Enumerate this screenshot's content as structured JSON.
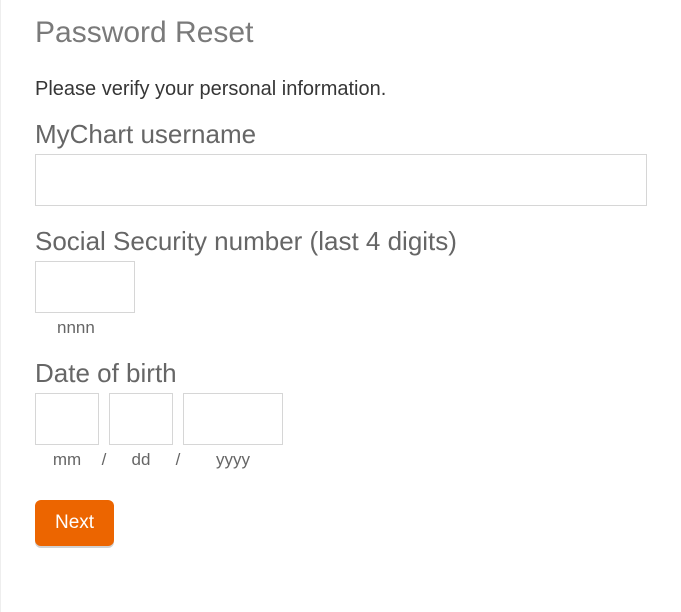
{
  "page": {
    "title": "Password Reset",
    "instruction": "Please verify your personal information."
  },
  "form": {
    "username": {
      "label": "MyChart username",
      "value": ""
    },
    "ssn": {
      "label": "Social Security number (last 4 digits)",
      "value": "",
      "hint": "nnnn"
    },
    "dob": {
      "label": "Date of birth",
      "month": {
        "value": "",
        "hint": "mm"
      },
      "day": {
        "value": "",
        "hint": "dd"
      },
      "year": {
        "value": "",
        "hint": "yyyy"
      },
      "separator": "/"
    }
  },
  "actions": {
    "next_label": "Next"
  }
}
